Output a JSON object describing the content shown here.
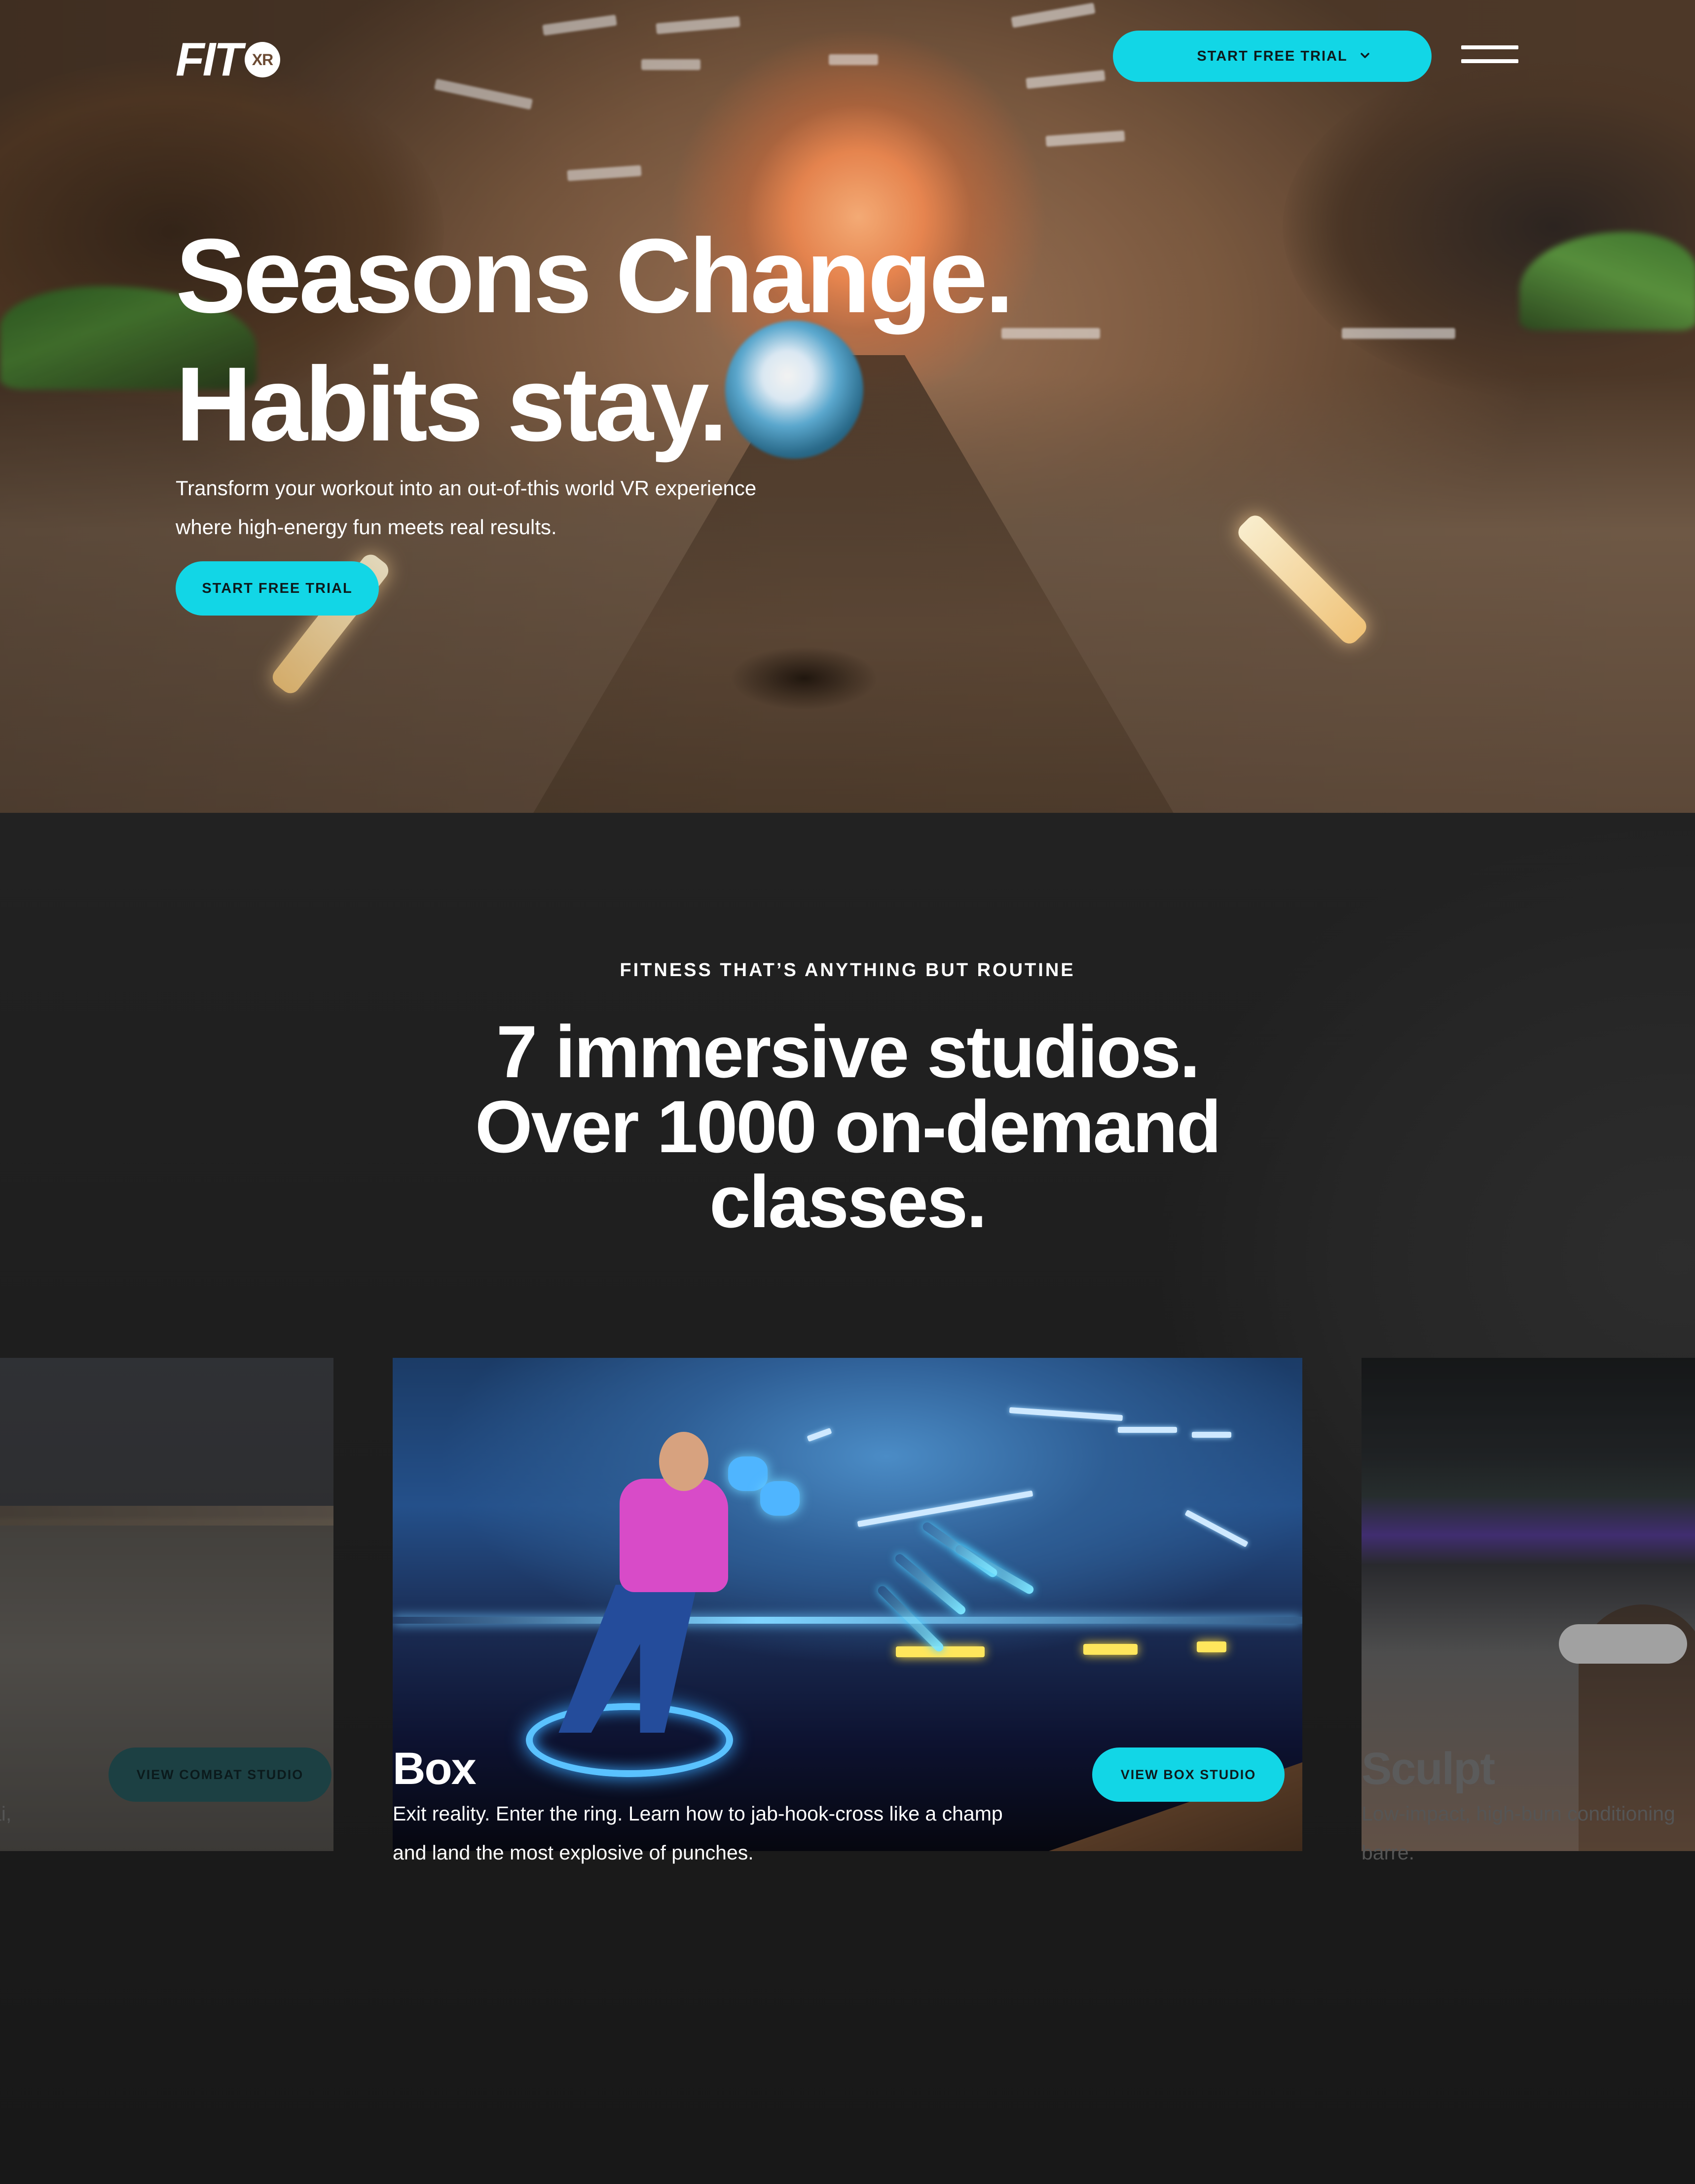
{
  "brand": {
    "logo_text": "FIT",
    "logo_badge": "XR",
    "accent_color": "#12d6e6"
  },
  "header": {
    "cta_label": "START FREE TRIAL",
    "cta_icon": "chevron-down-icon",
    "menu_icon": "hamburger-menu-icon"
  },
  "hero": {
    "title_line1": "Seasons Change.",
    "title_line2": "Habits stay.",
    "subtitle_line1": "Transform your workout into an out-of-this world VR experience",
    "subtitle_line2": "where high-energy fun meets real results.",
    "cta_label": "START FREE TRIAL"
  },
  "studios": {
    "eyebrow": "FITNESS THAT’S ANYTHING BUT ROUTINE",
    "title_line1": "7 immersive studios.",
    "title_line2": "Over 1000 on-demand",
    "title_line3": "classes.",
    "cards": [
      {
        "title": "",
        "description": "ai,",
        "button_label": "VIEW COMBAT STUDIO"
      },
      {
        "title": "Box",
        "description_line1": "Exit reality. Enter the ring. Learn how to jab-hook-cross like a champ",
        "description_line2": "and land the most explosive of punches.",
        "button_label": "VIEW BOX STUDIO"
      },
      {
        "title": "Sculpt",
        "description_line1": "Low-impact, high-burn conditioning",
        "description_line2": "barre."
      }
    ]
  }
}
